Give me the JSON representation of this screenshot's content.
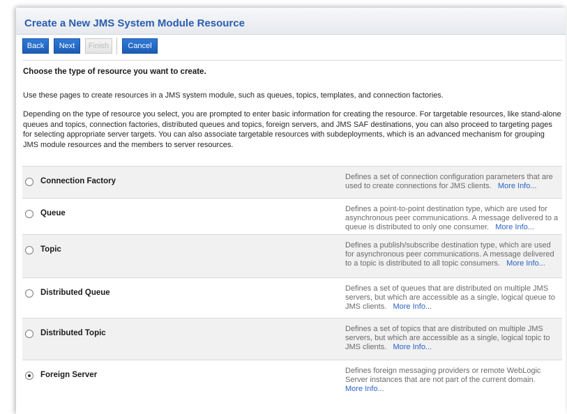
{
  "page": {
    "title": "Create a New JMS System Module Resource",
    "buttons": {
      "back": "Back",
      "next": "Next",
      "finish": "Finish",
      "cancel": "Cancel"
    },
    "heading": "Choose the type of resource you want to create.",
    "intro": "Use these pages to create resources in a JMS system module, such as queues, topics, templates, and connection factories.",
    "details": "Depending on the type of resource you select, you are prompted to enter basic information for creating the resource. For targetable resources, like stand-alone queues and topics, connection factories, distributed queues and topics, foreign servers, and JMS SAF destinations, you can also proceed to targeting pages for selecting appropriate server targets. You can also associate targetable resources with subdeployments, which is an advanced mechanism for grouping JMS module resources and the members to server resources."
  },
  "options": [
    {
      "label": "Connection Factory",
      "description": "Defines a set of connection configuration parameters that are used to create connections for JMS clients.",
      "more": "More Info...",
      "selected": false
    },
    {
      "label": "Queue",
      "description": "Defines a point-to-point destination type, which are used for asynchronous peer communications. A message delivered to a queue is distributed to only one consumer.",
      "more": "More Info...",
      "selected": false
    },
    {
      "label": "Topic",
      "description": "Defines a publish/subscribe destination type, which are used for asynchronous peer communications. A message delivered to a topic is distributed to all topic consumers.",
      "more": "More Info...",
      "selected": false
    },
    {
      "label": "Distributed Queue",
      "description": "Defines a set of queues that are distributed on multiple JMS servers, but which are accessible as a single, logical queue to JMS clients.",
      "more": "More Info...",
      "selected": false
    },
    {
      "label": "Distributed Topic",
      "description": "Defines a set of topics that are distributed on multiple JMS servers, but which are accessible as a single, logical topic to JMS clients.",
      "more": "More Info...",
      "selected": false
    },
    {
      "label": "Foreign Server",
      "description": "Defines foreign messaging providers or remote WebLogic Server instances that are not part of the current domain.",
      "more": "More Info...",
      "selected": true
    }
  ]
}
